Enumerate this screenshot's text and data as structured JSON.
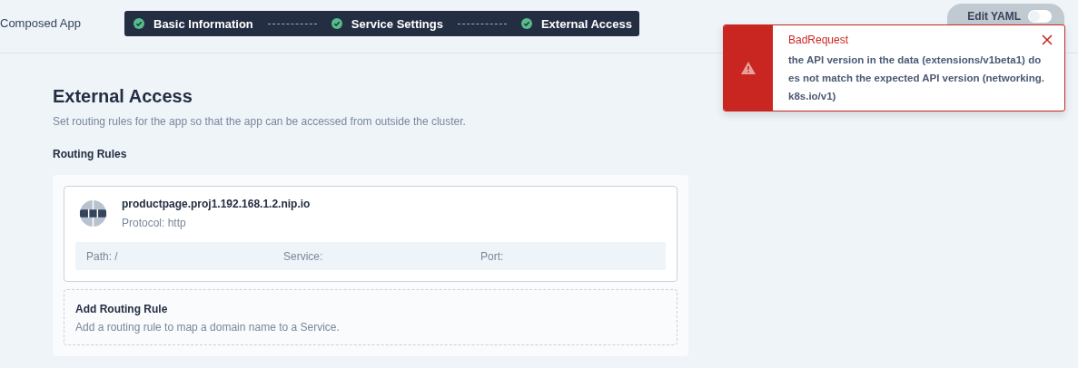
{
  "header": {
    "title": "Composed App",
    "steps": [
      {
        "label": "Basic Information",
        "done": true
      },
      {
        "label": "Service Settings",
        "done": true
      },
      {
        "label": "External Access",
        "done": true
      }
    ],
    "edit_yaml": {
      "label": "Edit YAML",
      "on": false
    }
  },
  "section": {
    "title": "External Access",
    "description": "Set routing rules for the app so that the app can be accessed from outside the cluster.",
    "subtitle": "Routing Rules"
  },
  "rules": [
    {
      "host": "productpage.proj1.192.168.1.2.nip.io",
      "protocol": "Protocol: http",
      "path": "Path: /",
      "service": "Service:",
      "port": "Port:"
    }
  ],
  "add_rule": {
    "title": "Add Routing Rule",
    "description": "Add a routing rule to map a domain name to a Service."
  },
  "toast": {
    "title": "BadRequest",
    "message": "the API version in the data (extensions/v1beta1) does not match the expected API version (networking.k8s.io/v1)"
  }
}
